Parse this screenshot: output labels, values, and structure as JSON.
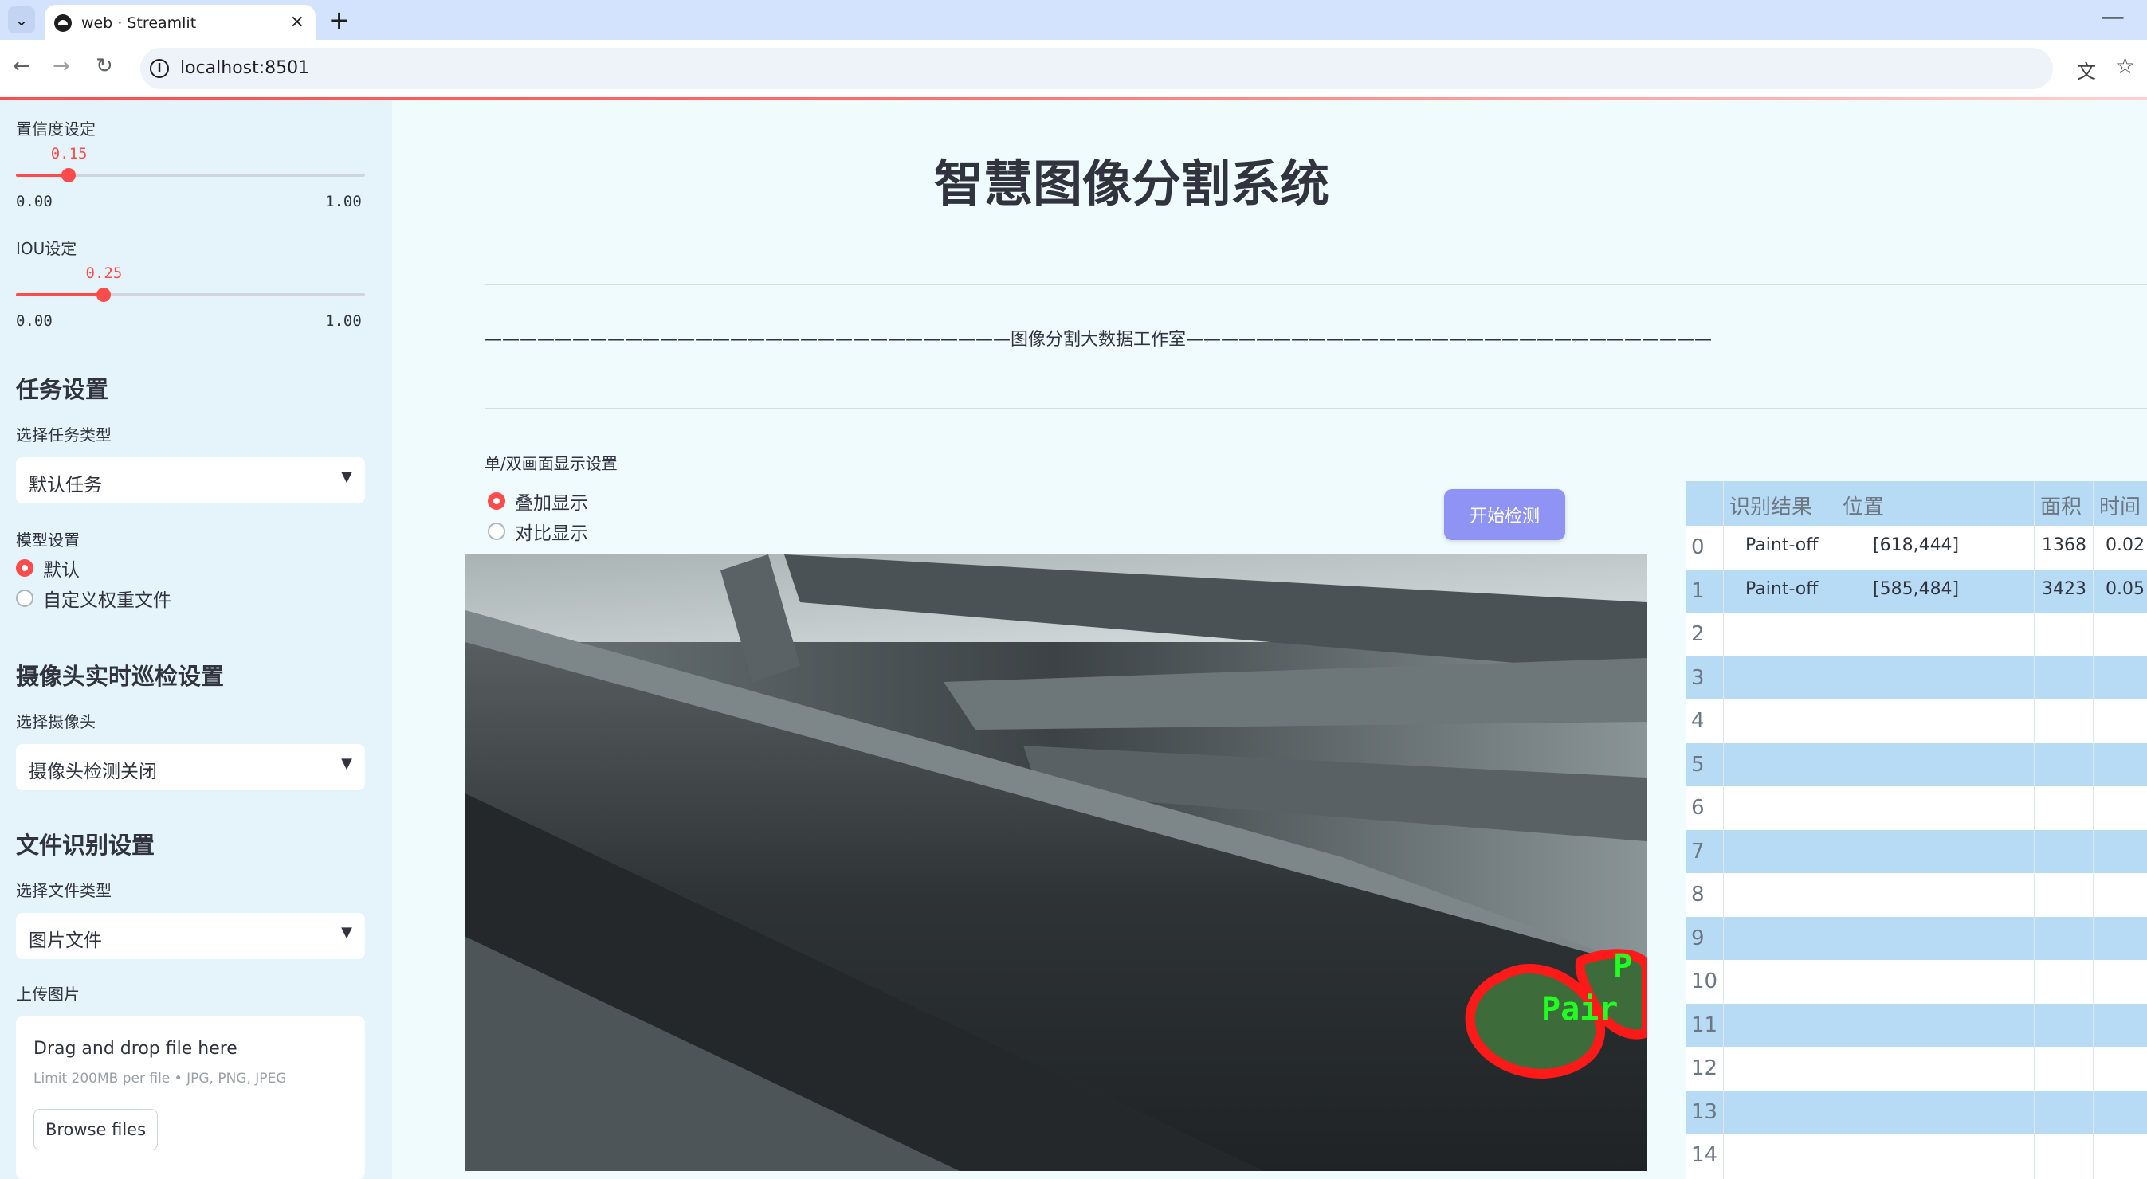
{
  "browser": {
    "tab_title": "web · Streamlit",
    "new_tab": "+",
    "close": "×",
    "url": "localhost:8501"
  },
  "sidebar": {
    "confidence_label": "置信度设定",
    "confidence_value": "0.15",
    "confidence_fraction": 0.15,
    "confidence_min": "0.00",
    "confidence_max": "1.00",
    "iou_label": "IOU设定",
    "iou_value": "0.25",
    "iou_fraction": 0.25,
    "iou_min": "0.00",
    "iou_max": "1.00",
    "task_heading": "任务设置",
    "task_type_label": "选择任务类型",
    "task_type_value": "默认任务",
    "model_label": "模型设置",
    "model_options": [
      "默认",
      "自定义权重文件"
    ],
    "model_selected": "默认",
    "camera_heading": "摄像头实时巡检设置",
    "camera_label": "选择摄像头",
    "camera_value": "摄像头检测关闭",
    "file_heading": "文件识别设置",
    "file_type_label": "选择文件类型",
    "file_type_value": "图片文件",
    "upload_label": "上传图片",
    "upload_title": "Drag and drop file here",
    "upload_hint": "Limit 200MB per file • JPG, PNG, JPEG",
    "browse_button": "Browse files"
  },
  "main": {
    "title": "智慧图像分割系统",
    "studio_line": "——————————————————————————————图像分割大数据工作室——————————————————————————————",
    "display_label": "单/双画面显示设置",
    "display_options": [
      "叠加显示",
      "对比显示"
    ],
    "display_selected": "叠加显示",
    "start_button": "开始检测",
    "overlay_text_1": "P",
    "overlay_text_2": "Pair"
  },
  "table": {
    "headers": [
      "识别结果",
      "位置",
      "面积",
      "时间"
    ],
    "rows": [
      {
        "index": "0",
        "result": "Paint-off",
        "position": "[618,444]",
        "area": "1368",
        "time": "0.02"
      },
      {
        "index": "1",
        "result": "Paint-off",
        "position": "[585,484]",
        "area": "3423",
        "time": "0.05"
      },
      {
        "index": "2"
      },
      {
        "index": "3"
      },
      {
        "index": "4"
      },
      {
        "index": "5"
      },
      {
        "index": "6"
      },
      {
        "index": "7"
      },
      {
        "index": "8"
      },
      {
        "index": "9"
      },
      {
        "index": "10"
      },
      {
        "index": "11"
      },
      {
        "index": "12"
      },
      {
        "index": "13"
      },
      {
        "index": "14"
      }
    ]
  },
  "colors": {
    "accent": "#ff4b4b",
    "button": "#8f94f4",
    "sidebar_bg": "#e4f4fa",
    "table_stripe": "#b7dbf4",
    "mask_outline": "#ff1a1a",
    "label_text": "#22ff22"
  }
}
